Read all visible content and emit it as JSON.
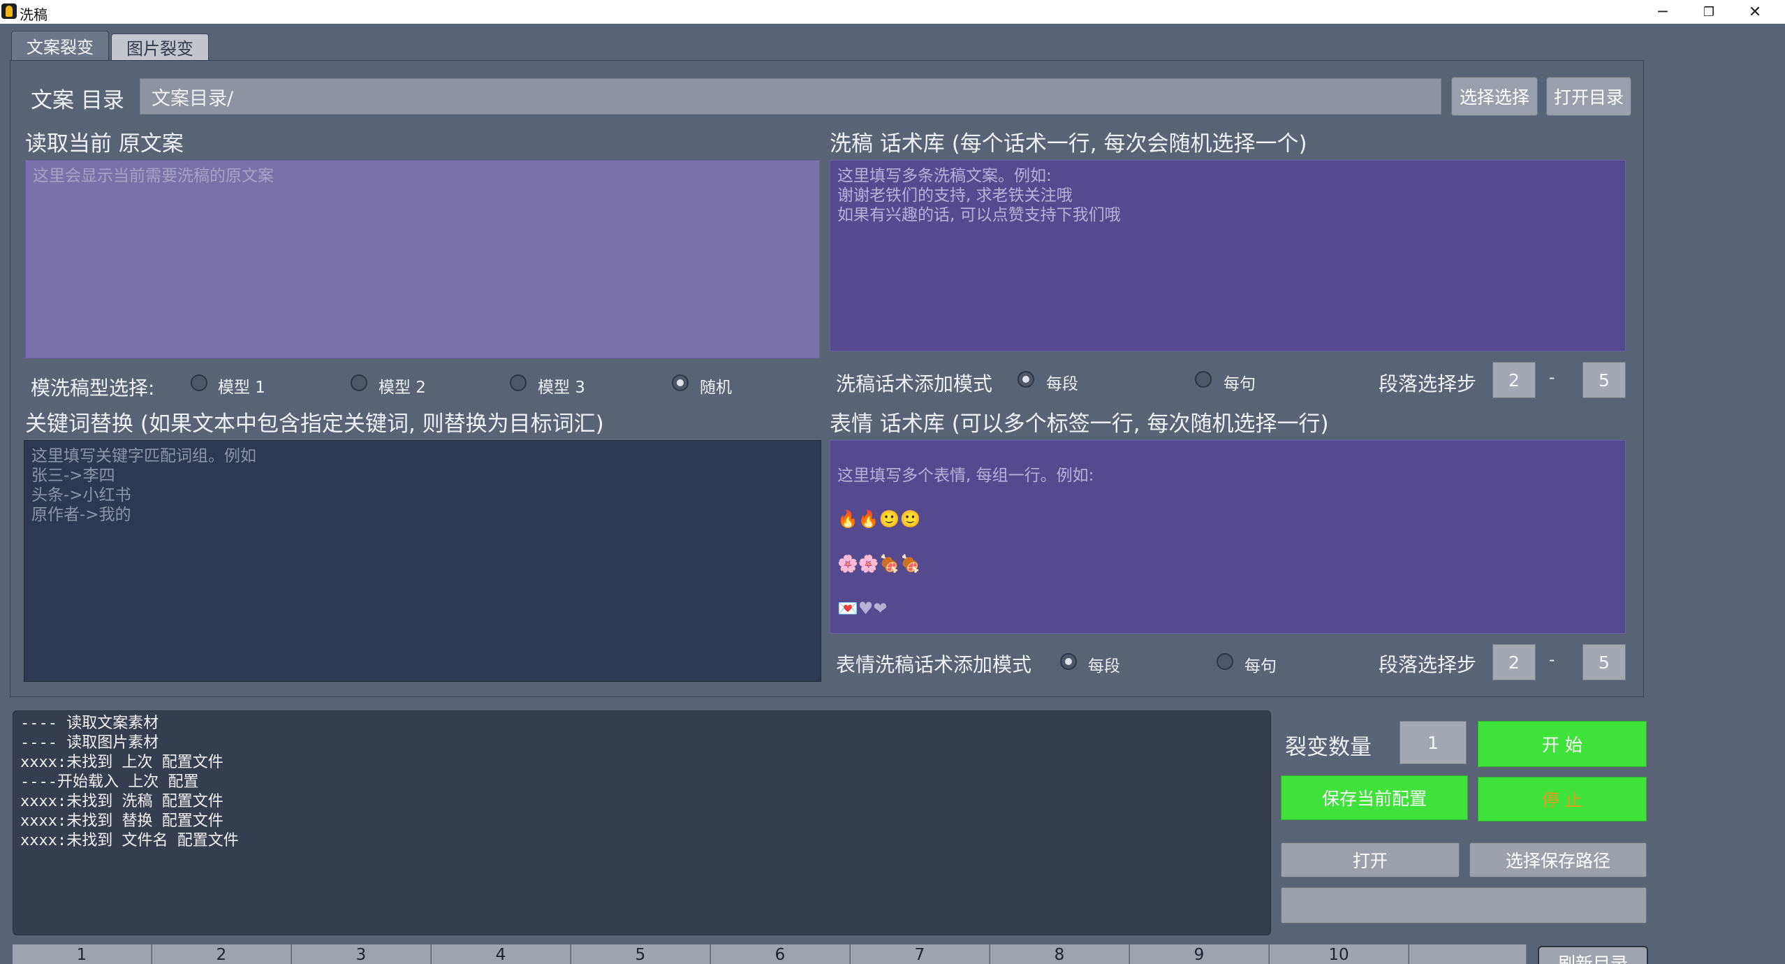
{
  "window": {
    "title": "洗稿",
    "minimize_glyph": "─",
    "restore_glyph": "❐",
    "close_glyph": "✕"
  },
  "tabs": [
    {
      "label": "文案裂变",
      "active": true
    },
    {
      "label": "图片裂变",
      "active": false
    }
  ],
  "copy_dir": {
    "label": "文案 目录",
    "value": "文案目录/",
    "select_button": "选择选择",
    "open_button": "打开目录"
  },
  "original": {
    "heading": "读取当前 原文案",
    "placeholder": "这里会显示当前需要洗稿的原文案"
  },
  "model_select": {
    "label": "模洗稿型选择:",
    "options": [
      "模型 1",
      "模型 2",
      "模型 3",
      "随机"
    ],
    "selected": "随机"
  },
  "wash_library": {
    "heading": "洗稿 话术库 (每个话术一行, 每次会随机选择一个)",
    "placeholder": "这里填写多条洗稿文案。例如:\n谢谢老铁们的支持, 求老铁关注哦\n如果有兴趣的话, 可以点赞支持下我们哦"
  },
  "wash_mode": {
    "label": "洗稿话术添加模式",
    "options": [
      "每段",
      "每句"
    ],
    "selected": "每段",
    "step_label": "段落选择步",
    "from": "2",
    "dash": "-",
    "to": "5"
  },
  "keyword": {
    "heading": "关键词替换 (如果文本中包含指定关键词, 则替换为目标词汇)",
    "placeholder": "这里填写关键字匹配词组。例如\n张三->李四\n头条->小红书\n原作者->我的"
  },
  "emoji_library": {
    "heading": "表情 话术库 (可以多个标签一行, 每次随机选择一行)",
    "placeholder_line": "这里填写多个表情, 每组一行。例如:",
    "rows": [
      "🔥🔥🙂🙂",
      "🌸🌸🍖🍖",
      "💌♥❤"
    ]
  },
  "emoji_mode": {
    "label": "表情洗稿话术添加模式",
    "options": [
      "每段",
      "每句"
    ],
    "selected": "每段",
    "step_label": "段落选择步",
    "from": "2",
    "dash": "-",
    "to": "5"
  },
  "log": {
    "lines": [
      "---- 读取文案素材",
      "---- 读取图片素材",
      "xxxx:未找到 上次 配置文件",
      "----开始载入 上次  配置",
      "xxxx:未找到 洗稿 配置文件",
      "xxxx:未找到 替换 配置文件",
      "xxxx:未找到 文件名 配置文件"
    ]
  },
  "controls": {
    "count_label": "裂变数量",
    "count_value": "1",
    "start_button": "开 始",
    "save_button": "保存当前配置",
    "stop_button": "停 止",
    "open_button": "打开",
    "save_path_button": "选择保存路径",
    "path_value": ""
  },
  "bottom_tabs": [
    "1",
    "2",
    "3",
    "4",
    "5",
    "6",
    "7",
    "8",
    "9",
    "10"
  ],
  "refresh_button": "刷新目录",
  "colors": {
    "bg": "#5a6275",
    "purple_dark": "#554a8f",
    "purple_light": "#7a71a7",
    "navy": "#2e3852",
    "green": "#3fe23a",
    "stop_text": "#e59a1d"
  }
}
